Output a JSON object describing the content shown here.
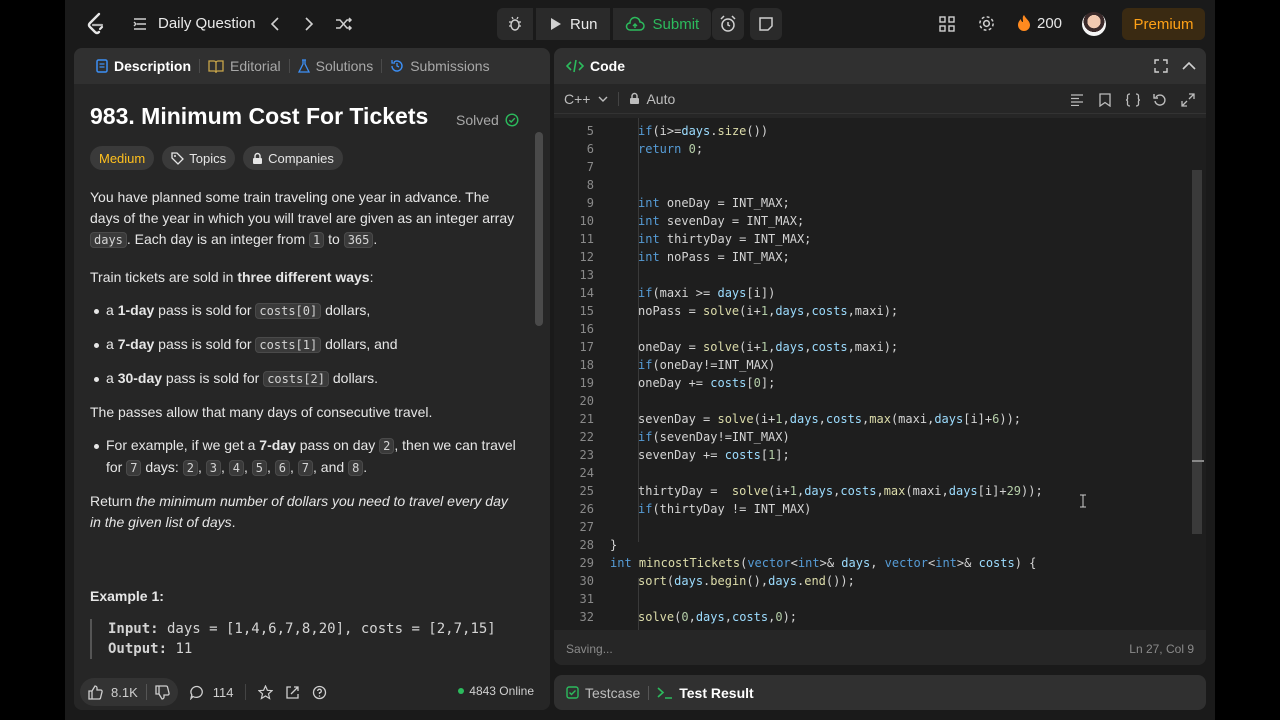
{
  "topbar": {
    "daily_label": "Daily Question",
    "run_label": "Run",
    "submit_label": "Submit",
    "streak_count": "200",
    "premium_label": "Premium"
  },
  "left_tabs": [
    {
      "label": "Description",
      "icon": "description-icon"
    },
    {
      "label": "Editorial",
      "icon": "book-icon"
    },
    {
      "label": "Solutions",
      "icon": "flask-icon"
    },
    {
      "label": "Submissions",
      "icon": "history-icon"
    }
  ],
  "problem": {
    "title": "983. Minimum Cost For Tickets",
    "status": "Solved",
    "difficulty": "Medium",
    "topics_label": "Topics",
    "companies_label": "Companies",
    "para1_a": "You have planned some train traveling one year in advance. The days of the year in which you will travel are given as an integer array ",
    "para1_code": "days",
    "para1_b": ". Each day is an integer from ",
    "para1_c1": "1",
    "para1_to": " to ",
    "para1_c2": "365",
    "para1_end": ".",
    "para2_a": "Train tickets are sold in ",
    "para2_bold": "three different ways",
    "para2_end": ":",
    "bullets": [
      {
        "pre": "a ",
        "bold": "1-day",
        "mid": " pass is sold for ",
        "code": "costs[0]",
        "post": " dollars,"
      },
      {
        "pre": "a ",
        "bold": "7-day",
        "mid": " pass is sold for ",
        "code": "costs[1]",
        "post": " dollars, and"
      },
      {
        "pre": "a ",
        "bold": "30-day",
        "mid": " pass is sold for ",
        "code": "costs[2]",
        "post": " dollars."
      }
    ],
    "para3": "The passes allow that many days of consecutive travel.",
    "example_bullet": {
      "pre": "For example, if we get a ",
      "bold": "7-day",
      "mid": " pass on day ",
      "day": "2",
      "mid2": ", then we can travel for ",
      "count": "7",
      "mid3": " days: ",
      "days": [
        "2",
        "3",
        "4",
        "5",
        "6",
        "7"
      ],
      "and": ", and ",
      "last": "8",
      "end": "."
    },
    "para4_a": "Return ",
    "para4_italic": "the minimum number of dollars you need to travel every day in the given list of days",
    "para4_end": ".",
    "example_title": "Example 1:",
    "example_input_label": "Input:",
    "example_input": " days = [1,4,6,7,8,20], costs = [2,7,15]",
    "example_output_label": "Output:",
    "example_output": " 11"
  },
  "left_footer": {
    "likes": "8.1K",
    "comments": "114",
    "online": "4843 Online"
  },
  "code_panel": {
    "title": "Code",
    "language": "C++",
    "mode": "Auto",
    "status_left": "Saving...",
    "status_right": "Ln 27, Col 9"
  },
  "code_lines": [
    {
      "n": "5",
      "text": "        if(i>=days.size())"
    },
    {
      "n": "6",
      "text": "        return 0;"
    },
    {
      "n": "7",
      "text": ""
    },
    {
      "n": "8",
      "text": ""
    },
    {
      "n": "9",
      "text": "        int oneDay = INT_MAX;"
    },
    {
      "n": "10",
      "text": "        int sevenDay = INT_MAX;"
    },
    {
      "n": "11",
      "text": "        int thirtyDay = INT_MAX;"
    },
    {
      "n": "12",
      "text": "        int noPass = INT_MAX;"
    },
    {
      "n": "13",
      "text": ""
    },
    {
      "n": "14",
      "text": "        if(maxi >= days[i])"
    },
    {
      "n": "15",
      "text": "        noPass = solve(i+1,days,costs,maxi);"
    },
    {
      "n": "16",
      "text": ""
    },
    {
      "n": "17",
      "text": "        oneDay = solve(i+1,days,costs,maxi);"
    },
    {
      "n": "18",
      "text": "        if(oneDay!=INT_MAX)"
    },
    {
      "n": "19",
      "text": "        oneDay += costs[0];"
    },
    {
      "n": "20",
      "text": ""
    },
    {
      "n": "21",
      "text": "        sevenDay = solve(i+1,days,costs,max(maxi,days[i]+6));"
    },
    {
      "n": "22",
      "text": "        if(sevenDay!=INT_MAX)"
    },
    {
      "n": "23",
      "text": "        sevenDay += costs[1];"
    },
    {
      "n": "24",
      "text": ""
    },
    {
      "n": "25",
      "text": "        thirtyDay =  solve(i+1,days,costs,max(maxi,days[i]+29));"
    },
    {
      "n": "26",
      "text": "        if(thirtyDay != INT_MAX)"
    },
    {
      "n": "27",
      "text": ""
    },
    {
      "n": "28",
      "text": "    }"
    },
    {
      "n": "29",
      "text": "    int mincostTickets(vector<int>& days, vector<int>& costs) {"
    },
    {
      "n": "30",
      "text": "        sort(days.begin(),days.end());"
    },
    {
      "n": "31",
      "text": ""
    },
    {
      "n": "32",
      "text": "        solve(0,days,costs,0);"
    }
  ],
  "bottom_tabs": {
    "testcase": "Testcase",
    "test_result": "Test Result"
  },
  "colors": {
    "accent_green": "#2cbb5d",
    "medium_yellow": "#ffc01e",
    "premium_orange": "#ffa116"
  }
}
